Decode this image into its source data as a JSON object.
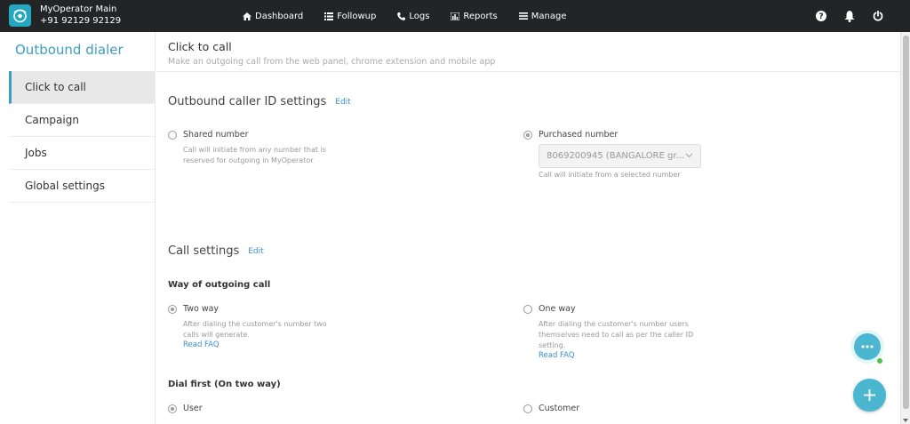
{
  "topbar": {
    "brand_name": "MyOperator Main",
    "brand_number": "+91 92129 92129",
    "nav": [
      {
        "label": "Dashboard",
        "icon": "home-icon"
      },
      {
        "label": "Followup",
        "icon": "list-icon"
      },
      {
        "label": "Logs",
        "icon": "phone-icon"
      },
      {
        "label": "Reports",
        "icon": "bar-chart-icon"
      },
      {
        "label": "Manage",
        "icon": "menu-icon"
      }
    ],
    "icons": [
      "help-icon",
      "bell-icon",
      "power-icon"
    ]
  },
  "sidebar": {
    "title": "Outbound dialer",
    "items": [
      {
        "label": "Click to call",
        "active": true
      },
      {
        "label": "Campaign",
        "active": false
      },
      {
        "label": "Jobs",
        "active": false
      },
      {
        "label": "Global settings",
        "active": false
      }
    ]
  },
  "page": {
    "title": "Click to call",
    "subtitle": "Make an outgoing call from the web panel, chrome extension and mobile app"
  },
  "caller_id": {
    "title": "Outbound caller ID settings",
    "edit": "Edit",
    "shared": {
      "label": "Shared number",
      "desc_line1": "Call will initiate from any number that is",
      "desc_line2": "reserved for outgoing in MyOperator",
      "checked": false
    },
    "purchased": {
      "label": "Purchased number",
      "select_value": "8069200945 (BANGALORE gr...",
      "desc": "Call will initiate from a selected number",
      "checked": true
    }
  },
  "call_settings": {
    "title": "Call settings",
    "edit": "Edit",
    "way_heading": "Way of outgoing call",
    "two_way": {
      "label": "Two way",
      "desc_line1": "After dialing the customer's number two",
      "desc_line2": "calls will generate.",
      "faq": "Read FAQ",
      "checked": true
    },
    "one_way": {
      "label": "One way",
      "desc_line1": "After dialing the customer's number users",
      "desc_line2": "themselves need to call as per the caller ID",
      "desc_line3": "setting.",
      "faq": "Read FAQ",
      "checked": false
    },
    "dial_first_heading": "Dial first (On two way)",
    "dial_user": {
      "label": "User",
      "checked": true
    },
    "dial_customer": {
      "label": "Customer",
      "checked": false
    }
  },
  "colors": {
    "topbar": "#222426",
    "accent": "#3c9fc0",
    "link": "#3c8ecf",
    "fab": "#4ab6cf",
    "online": "#4cc24a"
  }
}
